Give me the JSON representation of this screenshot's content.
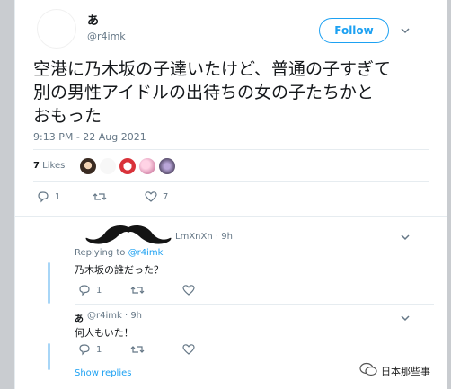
{
  "tweet": {
    "display_name": "あ",
    "handle": "@r4imk",
    "follow_label": "Follow",
    "text_lines": [
      "空港に乃木坂の子達いたけど、普通の子すぎて",
      "別の男性アイドルの出待ちの女の子たちかと",
      "おもった"
    ],
    "timestamp": "9:13 PM - 22 Aug 2021",
    "likes_count": "7",
    "likes_label": "Likes",
    "reply_count": "1",
    "like_count": "7"
  },
  "replies": [
    {
      "meta": "LmXnXn · 9h",
      "replying_prefix": "Replying to",
      "replying_handle": "@r4imk",
      "text": "乃木坂の誰だった？",
      "reply_count": "1"
    },
    {
      "name": "あ",
      "meta": "@r4imk · 9h",
      "text": "何人もいた！",
      "reply_count": "1"
    }
  ],
  "show_replies_label": "Show replies",
  "watermark_text": "日本那些事",
  "colors": {
    "accent": "#1da1f2",
    "text": "#14171a",
    "muted": "#657786",
    "thread_line": "#a8d6f7",
    "page_bg": "#c9ccd0"
  },
  "icons": {
    "follow_menu": "chevron-down-icon",
    "reply": "reply-icon",
    "retweet": "retweet-icon",
    "like": "heart-icon",
    "watermark": "wechat-icon"
  }
}
